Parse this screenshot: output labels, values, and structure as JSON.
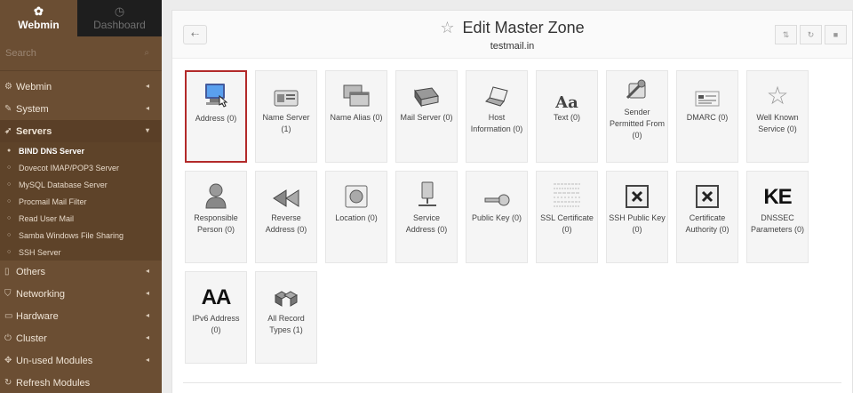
{
  "sidebar": {
    "tabs": [
      {
        "label": "Webmin",
        "icon": "webmin-icon"
      },
      {
        "label": "Dashboard",
        "icon": "dashboard-icon"
      }
    ],
    "search": {
      "placeholder": "Search"
    },
    "menu": [
      {
        "label": "Webmin",
        "icon": "gear-icon"
      },
      {
        "label": "System",
        "icon": "wrench-icon"
      },
      {
        "label": "Servers",
        "icon": "rocket-icon"
      },
      {
        "label": "Others",
        "icon": "file-icon"
      },
      {
        "label": "Networking",
        "icon": "shield-icon"
      },
      {
        "label": "Hardware",
        "icon": "drive-icon"
      },
      {
        "label": "Cluster",
        "icon": "power-icon"
      },
      {
        "label": "Un-used Modules",
        "icon": "puzzle-icon"
      },
      {
        "label": "Refresh Modules",
        "icon": "refresh-icon"
      }
    ],
    "servers_submenu": [
      "BIND DNS Server",
      "Dovecot IMAP/POP3 Server",
      "MySQL Database Server",
      "Procmail Mail Filter",
      "Read User Mail",
      "Samba Windows File Sharing",
      "SSH Server"
    ]
  },
  "header": {
    "title": "Edit Master Zone",
    "subtitle": "testmail.in"
  },
  "records": [
    {
      "label": "Address (0)",
      "icon": "computer-icon"
    },
    {
      "label": "Name Server (1)",
      "icon": "name-card-icon"
    },
    {
      "label": "Name Alias (0)",
      "icon": "windows-icon"
    },
    {
      "label": "Mail Server (0)",
      "icon": "mail-server-icon"
    },
    {
      "label": "Host Information (0)",
      "icon": "laptop-icon"
    },
    {
      "label": "Text (0)",
      "icon": "font-icon"
    },
    {
      "label": "Sender Permitted From (0)",
      "icon": "tools-icon"
    },
    {
      "label": "DMARC (0)",
      "icon": "dmarc-icon"
    },
    {
      "label": "Well Known Service (0)",
      "icon": "star-icon"
    },
    {
      "label": "Responsible Person (0)",
      "icon": "person-icon"
    },
    {
      "label": "Reverse Address (0)",
      "icon": "rewind-icon"
    },
    {
      "label": "Location (0)",
      "icon": "globe-icon"
    },
    {
      "label": "Service Address (0)",
      "icon": "service-icon"
    },
    {
      "label": "Public Key (0)",
      "icon": "key-icon"
    },
    {
      "label": "SSL Certificate (0)",
      "icon": "certificate-icon"
    },
    {
      "label": "SSH Public Key (0)",
      "icon": "not-found-icon"
    },
    {
      "label": "Certificate Authority (0)",
      "icon": "not-found-icon"
    },
    {
      "label": "DNSSEC Parameters (0)",
      "icon": "dnssec-icon",
      "icon_text": "KE"
    },
    {
      "label": "IPv6 Address (0)",
      "icon": "ipv6-icon",
      "icon_text": "AA"
    },
    {
      "label": "All Record Types (1)",
      "icon": "cubes-icon"
    }
  ]
}
